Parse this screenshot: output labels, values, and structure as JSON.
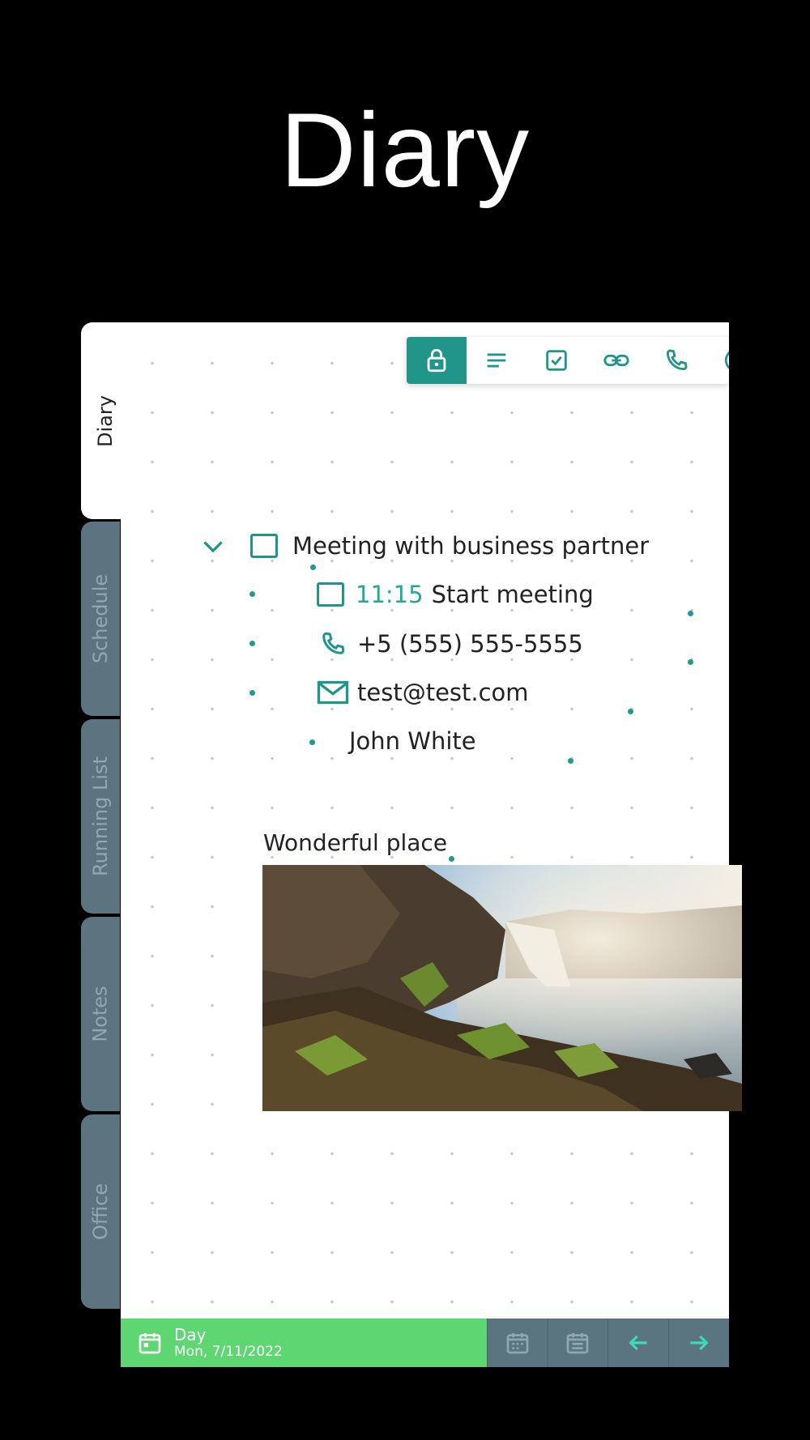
{
  "hero": {
    "title": "Diary"
  },
  "tabs": [
    "Diary",
    "Schedule",
    "Running List",
    "Notes",
    "Office"
  ],
  "toolbar": {
    "buttons": [
      "lock-icon",
      "text-icon",
      "checkbox-icon",
      "link-icon",
      "phone-icon",
      "at-icon"
    ]
  },
  "entries": {
    "task": "Meeting with business partner",
    "subtask_time": "11:15",
    "subtask_text": "Start meeting",
    "phone": "+5 (555) 555-5555",
    "email": "test@test.com",
    "name": "John White"
  },
  "note": {
    "caption": "Wonderful place"
  },
  "footer": {
    "view": "Day",
    "date": "Mon, 7/11/2022"
  },
  "colors": {
    "accent": "#22958a",
    "tab_inactive": "#5b7480",
    "footer_green": "#5ed672"
  }
}
